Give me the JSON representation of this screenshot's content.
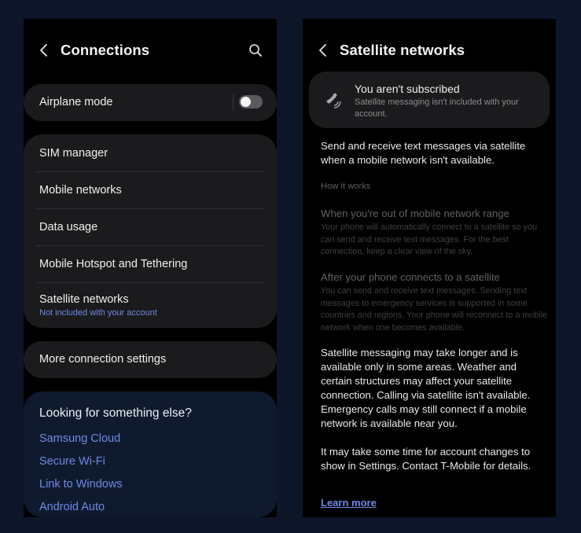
{
  "connections": {
    "title": "Connections",
    "airplane_mode": {
      "label": "Airplane mode",
      "enabled": false
    },
    "group_items": [
      {
        "label": "SIM manager"
      },
      {
        "label": "Mobile networks"
      },
      {
        "label": "Data usage"
      },
      {
        "label": "Mobile Hotspot and Tethering"
      },
      {
        "label": "Satellite networks",
        "sublabel": "Not included with your account"
      }
    ],
    "more_settings": "More connection settings",
    "suggestions": {
      "title": "Looking for something else?",
      "links": [
        "Samsung Cloud",
        "Secure Wi-Fi",
        "Link to Windows",
        "Android Auto"
      ]
    }
  },
  "satellite": {
    "title": "Satellite networks",
    "notice": {
      "title": "You aren't subscribed",
      "subtitle": "Satellite messaging isn't included with your account."
    },
    "intro": "Send and receive text messages via satellite when a mobile network isn't available.",
    "how_it_works_label": "How it works",
    "steps": [
      {
        "title": "When you're out of mobile network range",
        "body": "Your phone will automatically connect to a satellite so you can send and receive text messages. For the best connection, keep a clear view of the sky."
      },
      {
        "title": "After your phone connects to a satellite",
        "body": "You can send and receive text messages. Sending text messages to emergency services is supported in some countries and regions. Your phone will reconnect to a mobile network when one becomes available."
      }
    ],
    "disclaimer": "Satellite messaging may take longer and is available only in some areas. Weather and certain structures may affect your satellite connection. Calling via satellite isn't available. Emergency calls may still connect if a mobile network is available near you.",
    "account_note": "It may take some time for account changes to show in Settings. Contact T-Mobile for details.",
    "learn_more": "Learn more"
  },
  "colors": {
    "background": "#0c1628",
    "card": "#1b1b1d",
    "accent_link": "#6e8ae6",
    "suggestion_card": "#0f1a2e"
  }
}
